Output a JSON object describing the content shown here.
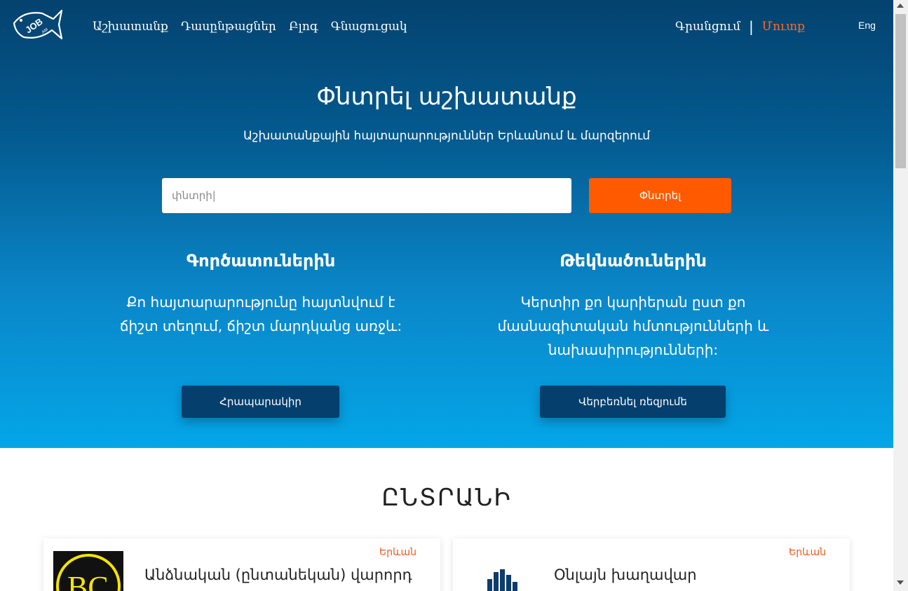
{
  "brand": {
    "logo_text": "JOB",
    "logo_suffix": ".AM"
  },
  "nav": {
    "items": [
      {
        "label": "Աշխատանք"
      },
      {
        "label": "Դասընթացներ"
      },
      {
        "label": "Բլոգ"
      },
      {
        "label": "Գնացուցակ"
      }
    ]
  },
  "auth": {
    "signup": "Գրանցում",
    "separator": "|",
    "login": "Մուտք"
  },
  "language": "Eng",
  "hero": {
    "title": "Փնտրել աշխատանք",
    "subtitle": "Աշխատանքային հայտարարություններ Երևանում և մարզերում"
  },
  "search": {
    "placeholder": "փնտրի|",
    "button": "Փնտրել"
  },
  "employers": {
    "title": "Գործատուներին",
    "text": "Քո հայտարարությունը հայտնվում է ճիշտ տեղում, ճիշտ մարդկանց առջև:",
    "button": "Հրապարակիր"
  },
  "candidates": {
    "title": "Թեկնածուներին",
    "text": "Կերտիր քո կարիերան ըստ քո մասնագիտական հմտությունների և նախասիրությունների:",
    "button": "Վերբեռնել ռեզյումե"
  },
  "featured": {
    "title": "ԸՆՏՐԱՆԻ",
    "cards": [
      {
        "city": "Երևան",
        "job": "Անձնական (ընտանեկան) վարորդ",
        "logo_text": "BC"
      },
      {
        "city": "Երևան",
        "job": "Օնլայն խաղավար",
        "logo_text": ""
      }
    ]
  },
  "colors": {
    "hero_top": "#04426f",
    "hero_bottom": "#04a6e8",
    "accent": "#ff5a00",
    "cta_dark": "#043f6e"
  }
}
